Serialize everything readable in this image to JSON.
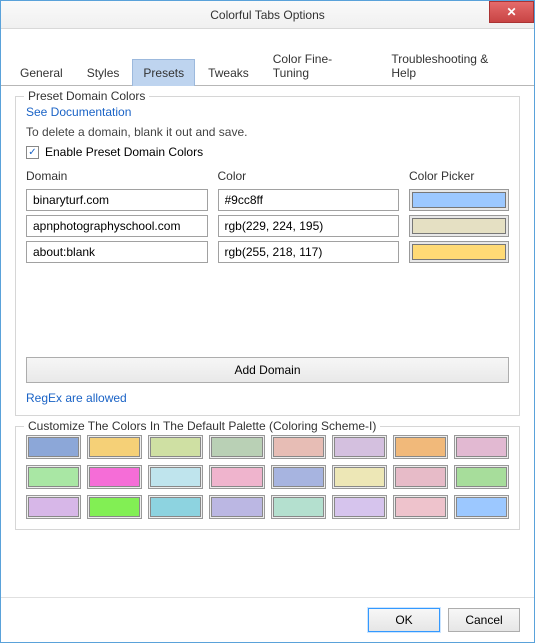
{
  "window": {
    "title": "Colorful Tabs Options"
  },
  "tabs": {
    "items": [
      {
        "label": "General"
      },
      {
        "label": "Styles"
      },
      {
        "label": "Presets"
      },
      {
        "label": "Tweaks"
      },
      {
        "label": "Color Fine-Tuning"
      },
      {
        "label": "Troubleshooting & Help"
      }
    ],
    "activeIndex": 2
  },
  "preset": {
    "groupTitle": "Preset Domain Colors",
    "docLink": "See Documentation",
    "instructions": "To delete a domain, blank it out and save.",
    "enableLabel": "Enable Preset Domain Colors",
    "enableChecked": true,
    "headers": {
      "domain": "Domain",
      "color": "Color",
      "picker": "Color Picker"
    },
    "rows": [
      {
        "domain": "binaryturf.com",
        "color": "#9cc8ff",
        "swatch": "#9cc8ff"
      },
      {
        "domain": "apnphotographyschool.com",
        "color": "rgb(229, 224, 195)",
        "swatch": "rgb(229, 224, 195)"
      },
      {
        "domain": "about:blank",
        "color": "rgb(255, 218, 117)",
        "swatch": "rgb(255, 218, 117)"
      }
    ],
    "addButton": "Add Domain",
    "regexNote": "RegEx are allowed"
  },
  "palette": {
    "title": "Customize The Colors In The Default Palette (Coloring Scheme-I)",
    "colors": [
      "#8ca7d8",
      "#f5d077",
      "#cfe0a3",
      "#b9d0b5",
      "#e7bdb5",
      "#d4c0df",
      "#f1b97a",
      "#e2b9d2",
      "#a9e7a4",
      "#f56dd7",
      "#bfe4ed",
      "#efb4cd",
      "#a7b4e0",
      "#ede7b6",
      "#e7bbc8",
      "#a7dd9b",
      "#d7b7e8",
      "#82ef54",
      "#8dd3e0",
      "#bbb7e3",
      "#b4e0cf",
      "#d6c4ed",
      "#eec3cc",
      "#9cc8ff"
    ]
  },
  "footer": {
    "ok": "OK",
    "cancel": "Cancel"
  }
}
